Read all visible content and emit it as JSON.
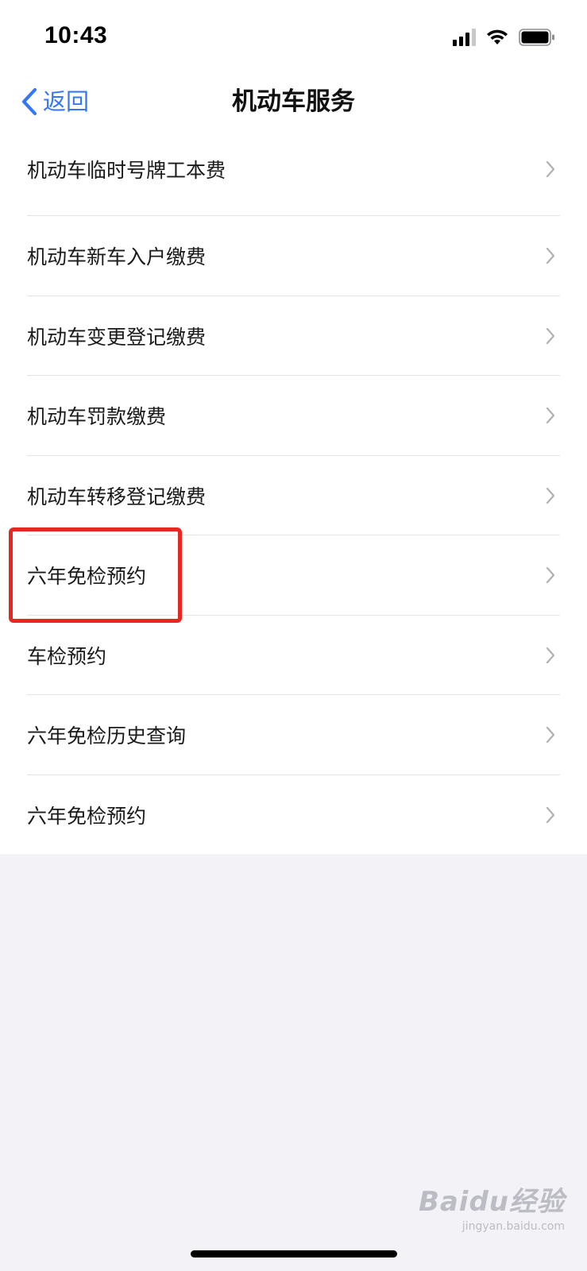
{
  "status_bar": {
    "time": "10:43"
  },
  "nav": {
    "back_label": "返回",
    "title": "机动车服务"
  },
  "items": [
    {
      "label": "机动车临时号牌工本费"
    },
    {
      "label": "机动车新车入户缴费"
    },
    {
      "label": "机动车变更登记缴费"
    },
    {
      "label": "机动车罚款缴费"
    },
    {
      "label": "机动车转移登记缴费"
    },
    {
      "label": "六年免检预约"
    },
    {
      "label": "车检预约"
    },
    {
      "label": "六年免检历史查询"
    },
    {
      "label": "六年免检预约"
    }
  ],
  "highlight": {
    "color": "#e8261f",
    "target_item": 5
  },
  "watermark": {
    "logo": "Baidu经验",
    "sub": "jingyan.baidu.com"
  },
  "colors": {
    "accent": "#3478f6",
    "background": "#f2f2f7",
    "card": "#ffffff"
  }
}
